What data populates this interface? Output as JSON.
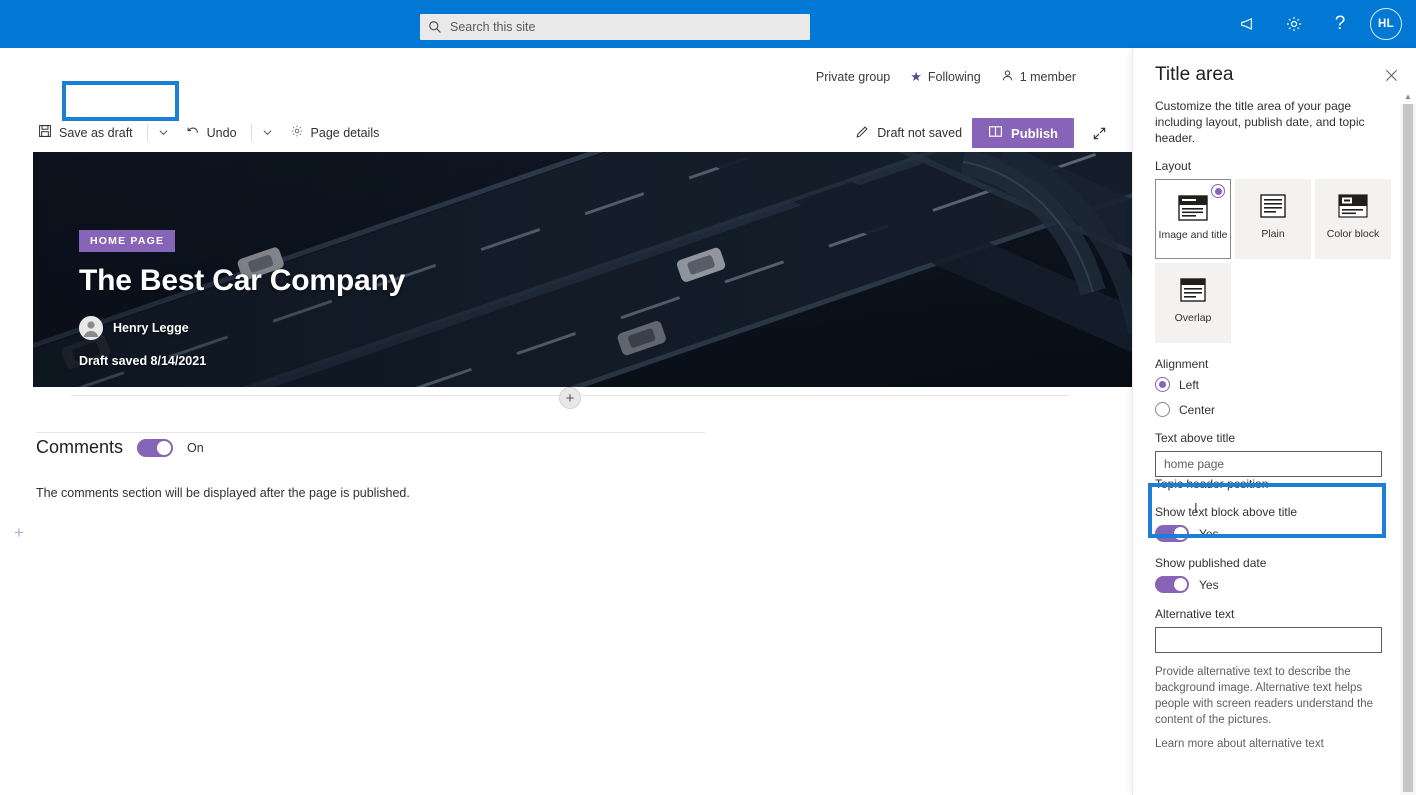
{
  "suite": {
    "search_placeholder": "Search this site",
    "icons": [
      "megaphone-icon",
      "gear-icon",
      "help-icon"
    ],
    "avatar_initials": "HL",
    "brand_color": "#0078d4"
  },
  "site_header": {
    "privacy": "Private group",
    "following": "Following",
    "members": "1 member"
  },
  "command_bar": {
    "save_label": "Save as draft",
    "undo_label": "Undo",
    "page_details_label": "Page details",
    "draft_status": "Draft not saved",
    "publish_label": "Publish",
    "publish_color": "#8764b8"
  },
  "hero": {
    "topic_header": "HOME PAGE",
    "title": "The Best Car Company",
    "author": "Henry Legge",
    "date_line": "Draft saved 8/14/2021"
  },
  "comments": {
    "title": "Comments",
    "toggle_state": "On",
    "note": "The comments section will be displayed after the page is published."
  },
  "panel": {
    "title": "Title area",
    "description": "Customize the title area of your page including layout, publish date, and topic header.",
    "layout_label": "Layout",
    "layouts": [
      {
        "name": "Image and title",
        "selected": true
      },
      {
        "name": "Plain",
        "selected": false
      },
      {
        "name": "Color block",
        "selected": false
      },
      {
        "name": "Overlap",
        "selected": false
      }
    ],
    "alignment_label": "Alignment",
    "alignment_options": [
      {
        "label": "Left",
        "selected": true
      },
      {
        "label": "Center",
        "selected": false
      }
    ],
    "text_above_title_label": "Text above title",
    "text_above_title_value": "home page",
    "obscured_label": "Topic header position",
    "show_text_block_label": "Show text block above title",
    "show_text_block_value": "Yes",
    "show_published_date_label": "Show published date",
    "show_published_date_value": "Yes",
    "alt_text_label": "Alternative text",
    "alt_text_value": "",
    "alt_help": "Provide alternative text to describe the background image. Alternative text helps people with screen readers understand the content of the pictures.",
    "alt_link": "Learn more about alternative text",
    "accent_color": "#8764b8",
    "annotation_color": "#1c7fd6"
  }
}
